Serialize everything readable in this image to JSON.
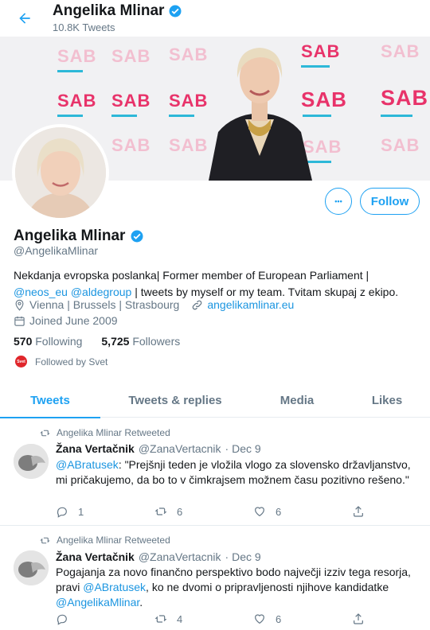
{
  "header": {
    "name": "Angelika Mlinar",
    "tweet_count": "10.8K Tweets"
  },
  "banner": {
    "party_text": "SAB"
  },
  "actions": {
    "more_label": "•••",
    "follow_label": "Follow"
  },
  "profile": {
    "name": "Angelika Mlinar",
    "handle": "@AngelikaMlinar",
    "bio_line1": "Nekdanja evropska poslanka| Former member of European Parliament |",
    "bio_mention1": "@neos_eu",
    "bio_mention2": "@aldegroup",
    "bio_line2_rest": " | tweets by myself or my team. Tvitam skupaj z ekipo.",
    "location": "Vienna | Brussels | Strasbourg",
    "website": "angelikamlinar.eu",
    "joined": "Joined June 2009",
    "following_count": "570",
    "following_label": "Following",
    "followers_count": "5,725",
    "followers_label": "Followers",
    "followed_by": "Followed by Svet",
    "followed_by_badge": "Svet"
  },
  "tabs": [
    {
      "label": "Tweets",
      "active": true
    },
    {
      "label": "Tweets & replies",
      "active": false
    },
    {
      "label": "Media",
      "active": false
    },
    {
      "label": "Likes",
      "active": false
    }
  ],
  "tweets": [
    {
      "retweet_label": "Angelika Mlinar Retweeted",
      "author": "Žana Vertačnik",
      "handle": "@ZanaVertacnik",
      "date": "· Dec 9",
      "mention": "@ABratusek",
      "text_rest": ": \"Prejšnji teden je vložila vlogo za slovensko državljanstvo, mi pričakujemo, da bo to v čimkrajsem možnem času pozitivno rešeno.\"",
      "replies": "1",
      "retweets": "6",
      "likes": "6"
    },
    {
      "retweet_label": "Angelika Mlinar Retweeted",
      "author": "Žana Vertačnik",
      "handle": "@ZanaVertacnik",
      "date": "· Dec 9",
      "text_pre": "Pogajanja za novo finančno perspektivo bodo največji izziv tega resorja, pravi ",
      "mention": "@ABratusek",
      "text_mid": ", ko ne dvomi o pripravljenosti njihove kandidatke ",
      "mention2": "@AngelikaMlinar",
      "text_end": ".",
      "replies": "",
      "retweets": "4",
      "likes": "6"
    }
  ],
  "icons": {
    "back": "arrow-left-icon",
    "verified": "verified-badge-icon",
    "location": "location-pin-icon",
    "link": "link-icon",
    "calendar": "calendar-icon",
    "retweet": "retweet-icon",
    "reply": "reply-icon",
    "like": "heart-icon",
    "share": "share-icon"
  },
  "colors": {
    "accent": "#1da1f2",
    "link": "#1b95e0",
    "muted": "#657786",
    "brand_pink": "#e8336a",
    "svet_red": "#e0262b"
  }
}
